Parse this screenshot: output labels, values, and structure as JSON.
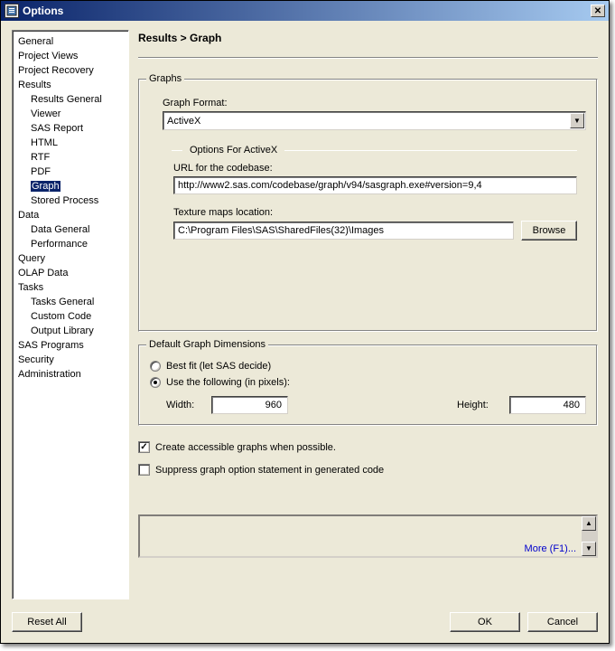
{
  "window": {
    "title": "Options"
  },
  "breadcrumb": "Results > Graph",
  "tree": {
    "items": [
      {
        "label": "General",
        "child": false
      },
      {
        "label": "Project Views",
        "child": false
      },
      {
        "label": "Project Recovery",
        "child": false
      },
      {
        "label": "Results",
        "child": false
      },
      {
        "label": "Results General",
        "child": true
      },
      {
        "label": "Viewer",
        "child": true
      },
      {
        "label": "SAS Report",
        "child": true
      },
      {
        "label": "HTML",
        "child": true
      },
      {
        "label": "RTF",
        "child": true
      },
      {
        "label": "PDF",
        "child": true
      },
      {
        "label": "Graph",
        "child": true,
        "selected": true
      },
      {
        "label": "Stored Process",
        "child": true
      },
      {
        "label": "Data",
        "child": false
      },
      {
        "label": "Data General",
        "child": true
      },
      {
        "label": "Performance",
        "child": true
      },
      {
        "label": "Query",
        "child": false
      },
      {
        "label": "OLAP Data",
        "child": false
      },
      {
        "label": "Tasks",
        "child": false
      },
      {
        "label": "Tasks General",
        "child": true
      },
      {
        "label": "Custom Code",
        "child": true
      },
      {
        "label": "Output Library",
        "child": true
      },
      {
        "label": "SAS Programs",
        "child": false
      },
      {
        "label": "Security",
        "child": false
      },
      {
        "label": "Administration",
        "child": false
      }
    ]
  },
  "graphs": {
    "legend": "Graphs",
    "format_label": "Graph Format:",
    "format_value": "ActiveX",
    "options_for": "Options For ActiveX",
    "url_label": "URL for the codebase:",
    "url_value": "http://www2.sas.com/codebase/graph/v94/sasgraph.exe#version=9,4",
    "texture_label": "Texture maps location:",
    "texture_value": "C:\\Program Files\\SAS\\SharedFiles(32)\\Images",
    "browse": "Browse"
  },
  "dims": {
    "legend": "Default Graph Dimensions",
    "best_fit": "Best fit (let SAS decide)",
    "use_following": "Use the following (in pixels):",
    "width_label": "Width:",
    "width": "960",
    "height_label": "Height:",
    "height": "480"
  },
  "checks": {
    "accessible": "Create accessible graphs when possible.",
    "suppress": "Suppress graph option statement in generated code"
  },
  "more": "More (F1)...",
  "footer": {
    "reset": "Reset All",
    "ok": "OK",
    "cancel": "Cancel"
  }
}
